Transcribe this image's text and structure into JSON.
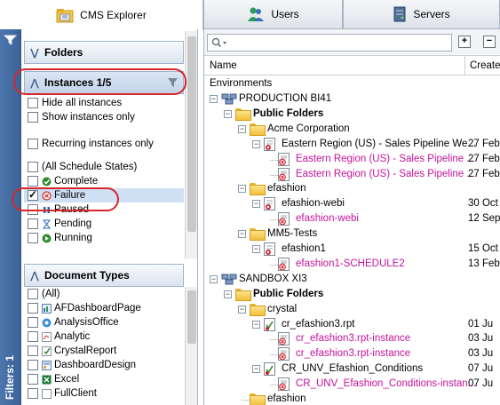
{
  "tabs": {
    "cms_explorer": "CMS Explorer",
    "users": "Users",
    "servers": "Servers"
  },
  "filter_strip": {
    "label": "Filters: 1"
  },
  "folders_section": {
    "title": "Folders"
  },
  "instances_section": {
    "title": "Instances 1/5",
    "options": [
      "Hide all instances",
      "Show instances only",
      "Recurring instances only"
    ],
    "states_header": "(All Schedule States)",
    "states": [
      {
        "label": "Complete",
        "checked": false,
        "icon": "complete-icon",
        "color": "#2e8b2e"
      },
      {
        "label": "Failure",
        "checked": true,
        "icon": "failure-icon",
        "color": "#d3202a"
      },
      {
        "label": "Paused",
        "checked": false,
        "icon": "paused-icon",
        "color": "#1f66c2"
      },
      {
        "label": "Pending",
        "checked": false,
        "icon": "pending-icon",
        "color": "#1f66c2"
      },
      {
        "label": "Running",
        "checked": false,
        "icon": "running-icon",
        "color": "#2e8b2e"
      }
    ]
  },
  "doc_types_section": {
    "title": "Document Types",
    "items": [
      "(All)",
      "AFDashboardPage",
      "AnalysisOffice",
      "Analytic",
      "CrystalReport",
      "DashboardDesign",
      "Excel",
      "FullClient"
    ]
  },
  "search": {
    "placeholder": ""
  },
  "columns": {
    "name": "Name",
    "created": "Create"
  },
  "tree": {
    "root": "Environments",
    "rows": [
      {
        "label": "PRODUCTION BI41",
        "type": "server",
        "bold": false,
        "pink": false,
        "date": ""
      },
      {
        "label": "Public Folders",
        "type": "folder",
        "bold": true,
        "pink": false,
        "date": ""
      },
      {
        "label": "Acme Corporation",
        "type": "folder",
        "bold": false,
        "pink": false,
        "date": ""
      },
      {
        "label": "Eastern Region (US) - Sales Pipeline We...",
        "type": "webi",
        "bold": false,
        "pink": false,
        "date": "27 Feb"
      },
      {
        "label": "Eastern Region (US) - Sales Pipeline ...",
        "type": "failed",
        "bold": false,
        "pink": true,
        "date": "27 Feb"
      },
      {
        "label": "Eastern Region (US) - Sales Pipeline ...",
        "type": "failed",
        "bold": false,
        "pink": true,
        "date": "27 Feb"
      },
      {
        "label": "efashion",
        "type": "folder",
        "bold": false,
        "pink": false,
        "date": ""
      },
      {
        "label": "efashion-webi",
        "type": "webi",
        "bold": false,
        "pink": false,
        "date": "30 Oct"
      },
      {
        "label": "efashion-webi",
        "type": "failed",
        "bold": false,
        "pink": true,
        "date": "12 Sep"
      },
      {
        "label": "MM5-Tests",
        "type": "folder",
        "bold": false,
        "pink": false,
        "date": ""
      },
      {
        "label": "efashion1",
        "type": "webi",
        "bold": false,
        "pink": false,
        "date": "15 Oct"
      },
      {
        "label": "efashion1-SCHEDULE2",
        "type": "failed",
        "bold": false,
        "pink": true,
        "date": "13 Feb"
      },
      {
        "label": "SANDBOX XI3",
        "type": "server",
        "bold": false,
        "pink": false,
        "date": ""
      },
      {
        "label": "Public Folders",
        "type": "folder",
        "bold": true,
        "pink": false,
        "date": ""
      },
      {
        "label": "crystal",
        "type": "folder",
        "bold": false,
        "pink": false,
        "date": ""
      },
      {
        "label": "cr_efashion3.rpt",
        "type": "crystal",
        "bold": false,
        "pink": false,
        "date": "01 Ju"
      },
      {
        "label": "cr_efashion3.rpt-instance",
        "type": "failed",
        "bold": false,
        "pink": true,
        "date": "03 Ju"
      },
      {
        "label": "cr_efashion3.rpt-instance",
        "type": "failed",
        "bold": false,
        "pink": true,
        "date": "03 Ju"
      },
      {
        "label": "CR_UNV_Efashion_Conditions",
        "type": "crystal",
        "bold": false,
        "pink": false,
        "date": "07 Ju"
      },
      {
        "label": "CR_UNV_Efashion_Conditions-instan...",
        "type": "failed",
        "bold": false,
        "pink": true,
        "date": "07 Ju"
      },
      {
        "label": "efashion",
        "type": "folder",
        "bold": false,
        "pink": false,
        "date": ""
      }
    ]
  },
  "colors": {
    "accent": "#4d76ad",
    "pink_text": "#c4139b",
    "annotation": "#d8252b",
    "selected_row": "#cfe0f5"
  }
}
